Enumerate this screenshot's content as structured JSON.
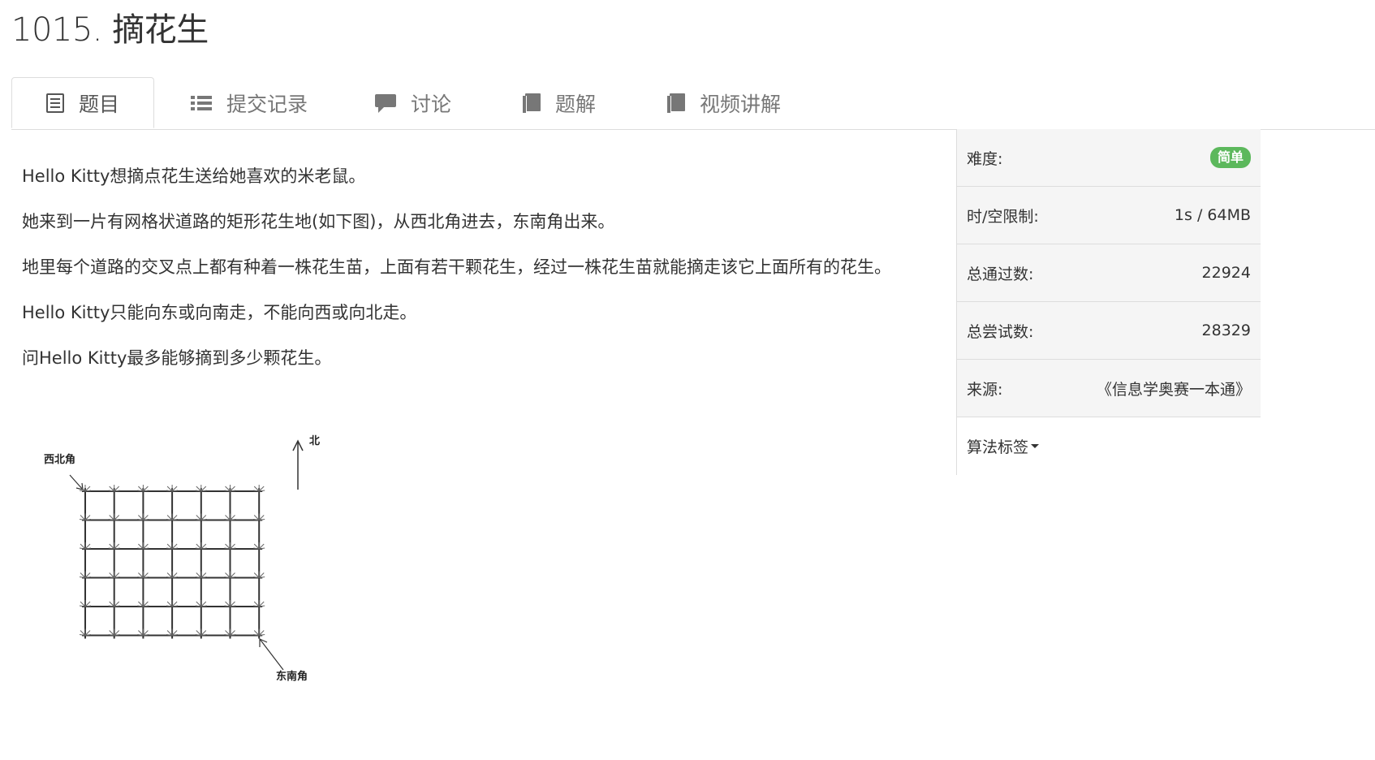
{
  "title": "1015. 摘花生",
  "tabs": [
    {
      "label": "题目",
      "icon": "list-alt-icon",
      "active": true
    },
    {
      "label": "提交记录",
      "icon": "list-icon",
      "active": false
    },
    {
      "label": "讨论",
      "icon": "comment-icon",
      "active": false
    },
    {
      "label": "题解",
      "icon": "book-icon",
      "active": false
    },
    {
      "label": "视频讲解",
      "icon": "book-icon",
      "active": false
    }
  ],
  "problem": {
    "paragraphs": [
      "Hello Kitty想摘点花生送给她喜欢的米老鼠。",
      "她来到一片有网格状道路的矩形花生地(如下图)，从西北角进去，东南角出来。",
      "地里每个道路的交叉点上都有种着一株花生苗，上面有若干颗花生，经过一株花生苗就能摘走该它上面所有的花生。",
      "Hello Kitty只能向东或向南走，不能向西或向北走。",
      "问Hello Kitty最多能够摘到多少颗花生。"
    ],
    "figure": {
      "label_nw": "西北角",
      "label_north": "北",
      "label_se": "东南角"
    }
  },
  "sidebar": {
    "difficulty_label": "难度:",
    "difficulty_value": "简单",
    "limit_label": "时/空限制:",
    "limit_value": "1s / 64MB",
    "accepted_label": "总通过数:",
    "accepted_value": "22924",
    "attempts_label": "总尝试数:",
    "attempts_value": "28329",
    "source_label": "来源:",
    "source_value": "《信息学奥赛一本通》",
    "tags_label": "算法标签"
  },
  "colors": {
    "badge": "#5cb85c",
    "border": "#dddddd",
    "panel_bg": "#f5f5f5"
  }
}
